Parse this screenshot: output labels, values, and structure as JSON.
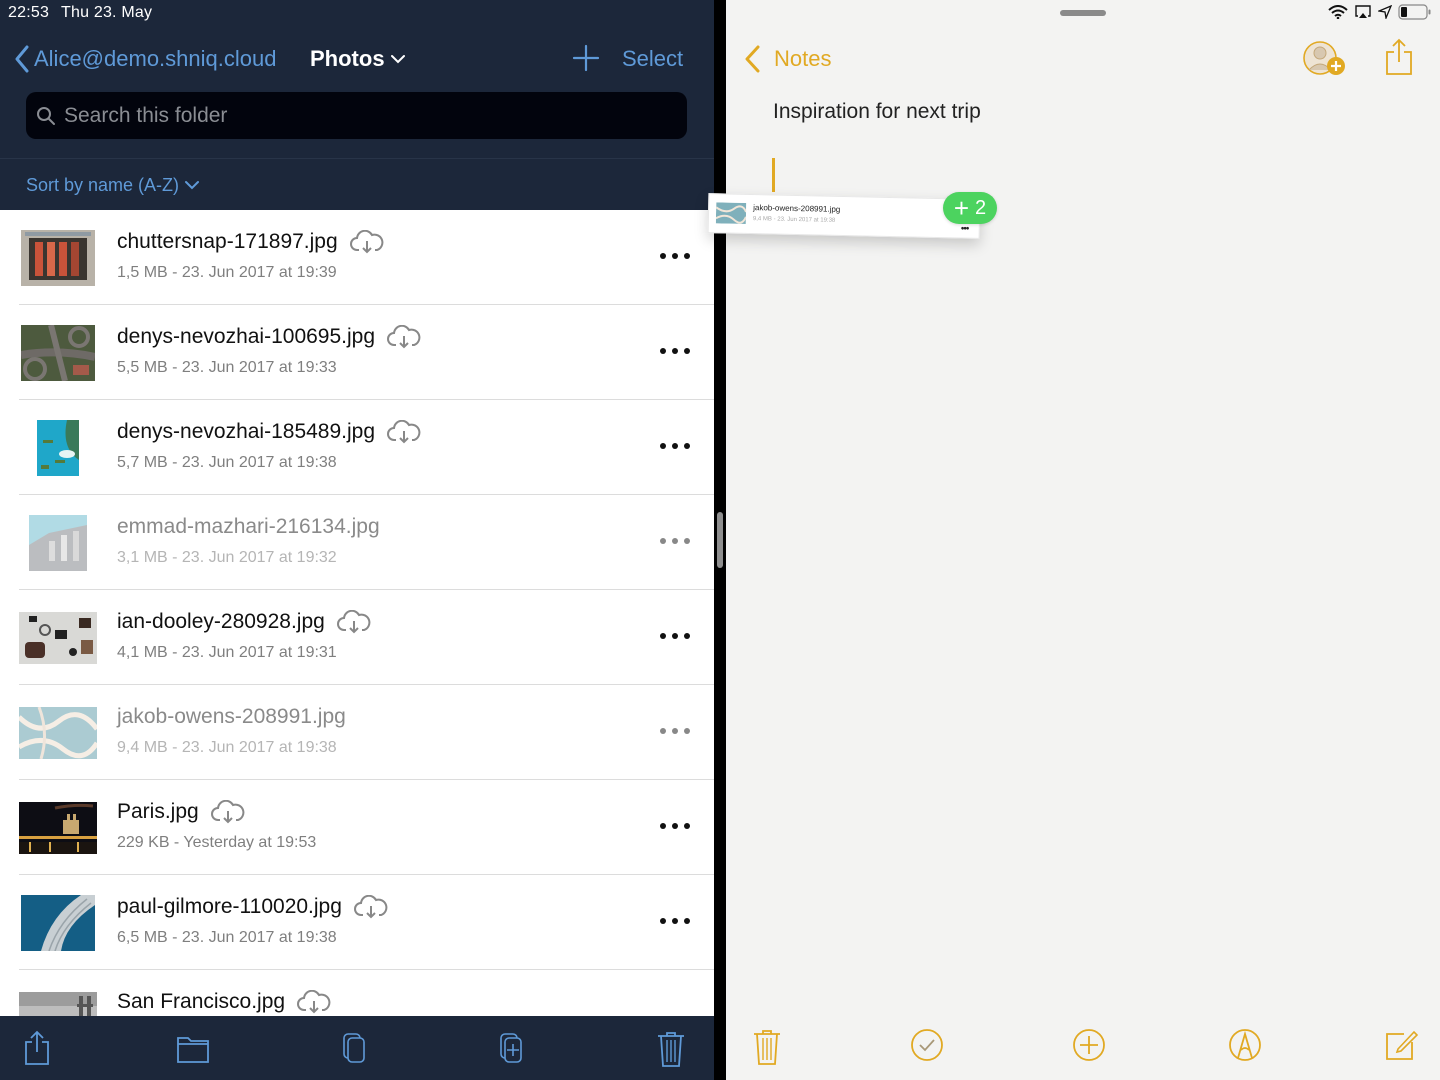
{
  "status_bar": {
    "time": "22:53",
    "date": "Thu 23. May"
  },
  "files_app": {
    "back_label": "Alice@demo.shniq.cloud",
    "title": "Photos",
    "select_label": "Select",
    "search": {
      "placeholder": "Search this folder",
      "value": ""
    },
    "sort_label": "Sort by name (A-Z)",
    "files": [
      {
        "name": "chuttersnap-171897.jpg",
        "meta": "1,5 MB - 23. Jun 2017 at 19:39",
        "cloud_icon": true,
        "dimmed": false
      },
      {
        "name": "denys-nevozhai-100695.jpg",
        "meta": "5,5 MB - 23. Jun 2017 at 19:33",
        "cloud_icon": true,
        "dimmed": false
      },
      {
        "name": "denys-nevozhai-185489.jpg",
        "meta": "5,7 MB - 23. Jun 2017 at 19:38",
        "cloud_icon": true,
        "dimmed": false
      },
      {
        "name": "emmad-mazhari-216134.jpg",
        "meta": "3,1 MB - 23. Jun 2017 at 19:32",
        "cloud_icon": false,
        "dimmed": true
      },
      {
        "name": "ian-dooley-280928.jpg",
        "meta": "4,1 MB - 23. Jun 2017 at 19:31",
        "cloud_icon": true,
        "dimmed": false
      },
      {
        "name": "jakob-owens-208991.jpg",
        "meta": "9,4 MB - 23. Jun 2017 at 19:38",
        "cloud_icon": false,
        "dimmed": true
      },
      {
        "name": "Paris.jpg",
        "meta": "229 KB - Yesterday at 19:53",
        "cloud_icon": true,
        "dimmed": false
      },
      {
        "name": "paul-gilmore-110020.jpg",
        "meta": "6,5 MB - 23. Jun 2017 at 19:38",
        "cloud_icon": true,
        "dimmed": false
      },
      {
        "name": "San Francisco.jpg",
        "meta": "",
        "cloud_icon": true,
        "dimmed": false
      }
    ],
    "toolbar": [
      "share-icon",
      "folder-icon",
      "copy-icon",
      "duplicate-icon",
      "trash-icon"
    ]
  },
  "notes_app": {
    "back_label": "Notes",
    "note_title": "Inspiration for next trip",
    "toolbar": [
      "trash-icon",
      "checklist-icon",
      "add-icon",
      "markup-icon",
      "compose-icon"
    ]
  },
  "drag_preview": {
    "name": "jakob-owens-208991.jpg",
    "meta": "9,4 MB - 23. Jun 2017 at 19:38",
    "badge_count": "2"
  },
  "colors": {
    "files_header_bg": "#1c273a",
    "files_accent": "#5f9ad8",
    "notes_accent": "#e1a923",
    "drag_badge": "#4cd35f"
  }
}
